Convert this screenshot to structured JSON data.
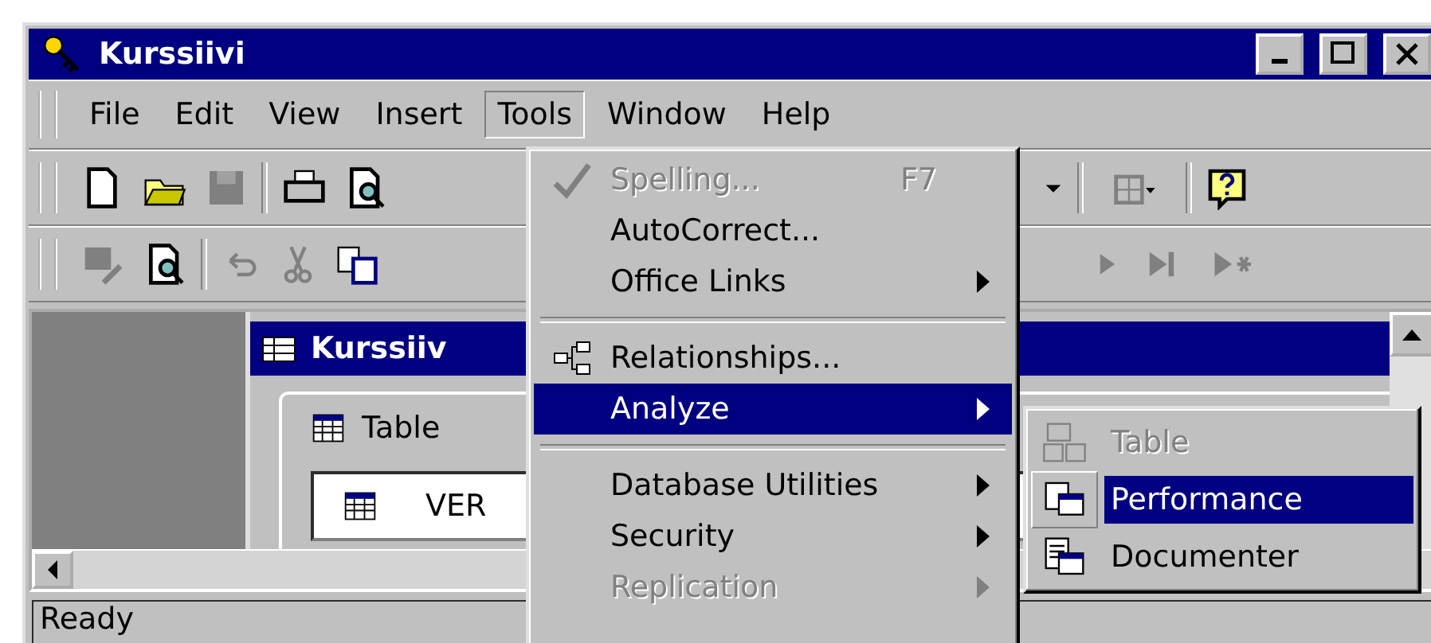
{
  "window": {
    "title": "Kurssiivi"
  },
  "menu_bar": [
    {
      "label": "File",
      "selected": false
    },
    {
      "label": "Edit",
      "selected": false
    },
    {
      "label": "View",
      "selected": false
    },
    {
      "label": "Insert",
      "selected": false
    },
    {
      "label": "Tools",
      "selected": true
    },
    {
      "label": "Window",
      "selected": false
    },
    {
      "label": "Help",
      "selected": false
    }
  ],
  "tools_menu": [
    {
      "kind": "item",
      "label": "Spelling...",
      "shortcut": "F7",
      "disabled": true,
      "selected": false,
      "submenu": false
    },
    {
      "kind": "item",
      "label": "AutoCorrect...",
      "disabled": false,
      "selected": false,
      "submenu": false
    },
    {
      "kind": "item",
      "label": "Office Links",
      "disabled": false,
      "selected": false,
      "submenu": true
    },
    {
      "kind": "separator"
    },
    {
      "kind": "item",
      "label": "Relationships...",
      "disabled": false,
      "selected": false,
      "submenu": false
    },
    {
      "kind": "item",
      "label": "Analyze",
      "disabled": false,
      "selected": true,
      "submenu": true
    },
    {
      "kind": "separator"
    },
    {
      "kind": "item",
      "label": "Database Utilities",
      "disabled": false,
      "selected": false,
      "submenu": true
    },
    {
      "kind": "item",
      "label": "Security",
      "disabled": false,
      "selected": false,
      "submenu": true
    },
    {
      "kind": "item",
      "label": "Replication",
      "disabled": true,
      "selected": false,
      "submenu": true
    }
  ],
  "analyze_submenu": [
    {
      "label": "Table",
      "disabled": true,
      "selected": false
    },
    {
      "label": "Performance",
      "disabled": false,
      "selected": true
    },
    {
      "label": "Documenter",
      "disabled": false,
      "selected": false
    }
  ],
  "document_window": {
    "title": "Kurssiiv",
    "tab": "Table",
    "list_item": "VER"
  },
  "status_bar": {
    "text": "Ready"
  }
}
